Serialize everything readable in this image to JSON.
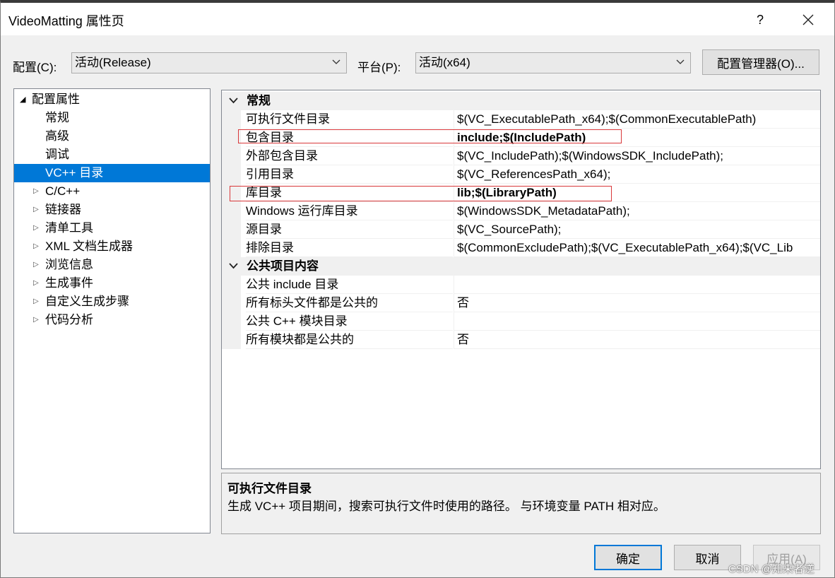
{
  "window": {
    "title": "VideoMatting 属性页",
    "help_label": "?"
  },
  "toolbar": {
    "config_label": "配置(C):",
    "config_value": "活动(Release)",
    "platform_label": "平台(P):",
    "platform_value": "活动(x64)",
    "config_manager_label": "配置管理器(O)..."
  },
  "tree": {
    "root": "配置属性",
    "children": [
      "常规",
      "高级",
      "调试",
      "VC++ 目录"
    ],
    "groups": [
      "C/C++",
      "链接器",
      "清单工具",
      "XML 文档生成器",
      "浏览信息",
      "生成事件",
      "自定义生成步骤",
      "代码分析"
    ]
  },
  "grid": {
    "categories": [
      {
        "name": "常规",
        "props": [
          {
            "name": "可执行文件目录",
            "value": "$(VC_ExecutablePath_x64);$(CommonExecutablePath)"
          },
          {
            "name": "包含目录",
            "value": "include;$(IncludePath)"
          },
          {
            "name": "外部包含目录",
            "value": "$(VC_IncludePath);$(WindowsSDK_IncludePath);"
          },
          {
            "name": "引用目录",
            "value": "$(VC_ReferencesPath_x64);"
          },
          {
            "name": "库目录",
            "value": "lib;$(LibraryPath)"
          },
          {
            "name": "Windows 运行库目录",
            "value": "$(WindowsSDK_MetadataPath);"
          },
          {
            "name": "源目录",
            "value": "$(VC_SourcePath);"
          },
          {
            "name": "排除目录",
            "value": "$(CommonExcludePath);$(VC_ExecutablePath_x64);$(VC_Lib"
          }
        ]
      },
      {
        "name": "公共项目内容",
        "props": [
          {
            "name": "公共 include 目录",
            "value": ""
          },
          {
            "name": "所有标头文件都是公共的",
            "value": "否"
          },
          {
            "name": "公共 C++ 模块目录",
            "value": ""
          },
          {
            "name": "所有模块都是公共的",
            "value": "否"
          }
        ]
      }
    ]
  },
  "description": {
    "title": "可执行文件目录",
    "text": "生成 VC++ 项目期间，搜索可执行文件时使用的路径。 与环境变量 PATH 相对应。"
  },
  "buttons": {
    "ok": "确定",
    "cancel": "取消",
    "apply": "应用(A)"
  },
  "watermark": "CSDN @知来者逆",
  "colors": {
    "selection": "#0078d7",
    "highlight_box": "#d9383a"
  }
}
